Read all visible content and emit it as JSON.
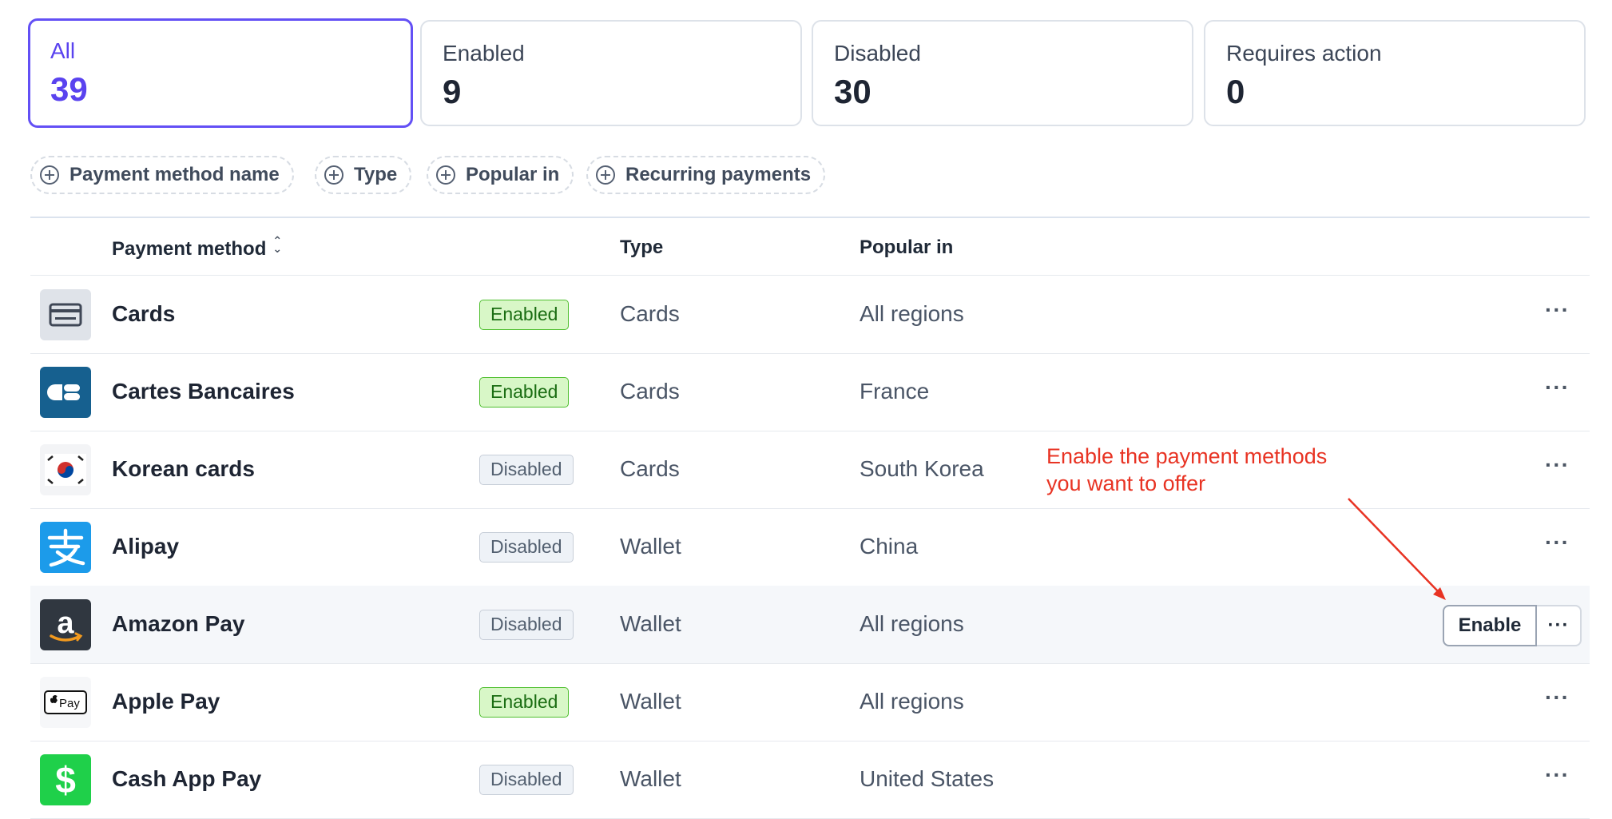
{
  "summary": [
    {
      "label": "All",
      "count": "39"
    },
    {
      "label": "Enabled",
      "count": "9"
    },
    {
      "label": "Disabled",
      "count": "30"
    },
    {
      "label": "Requires action",
      "count": "0"
    }
  ],
  "filters": [
    "Payment method name",
    "Type",
    "Popular in",
    "Recurring payments"
  ],
  "table": {
    "headers": {
      "method": "Payment method",
      "type": "Type",
      "popular": "Popular in"
    },
    "rows": [
      {
        "name": "Cards",
        "status": "Enabled",
        "type": "Cards",
        "popular": "All regions",
        "icon": "card-icon"
      },
      {
        "name": "Cartes Bancaires",
        "status": "Enabled",
        "type": "Cards",
        "popular": "France",
        "icon": "cartes-bancaires-logo"
      },
      {
        "name": "Korean cards",
        "status": "Disabled",
        "type": "Cards",
        "popular": "South Korea",
        "icon": "korean-flag-icon"
      },
      {
        "name": "Alipay",
        "status": "Disabled",
        "type": "Wallet",
        "popular": "China",
        "icon": "alipay-logo"
      },
      {
        "name": "Amazon Pay",
        "status": "Disabled",
        "type": "Wallet",
        "popular": "All regions",
        "icon": "amazon-logo"
      },
      {
        "name": "Apple Pay",
        "status": "Enabled",
        "type": "Wallet",
        "popular": "All regions",
        "icon": "apple-pay-logo"
      },
      {
        "name": "Cash App Pay",
        "status": "Disabled",
        "type": "Wallet",
        "popular": "United States",
        "icon": "cash-app-logo"
      }
    ]
  },
  "row_actions": {
    "more": "···",
    "enable": "Enable"
  },
  "annotation": {
    "line1": "Enable the payment methods",
    "line2": "you want to offer"
  },
  "colors": {
    "accent": "#5a43ef",
    "enabled": "#1a6d12",
    "annotation": "#e83323"
  }
}
